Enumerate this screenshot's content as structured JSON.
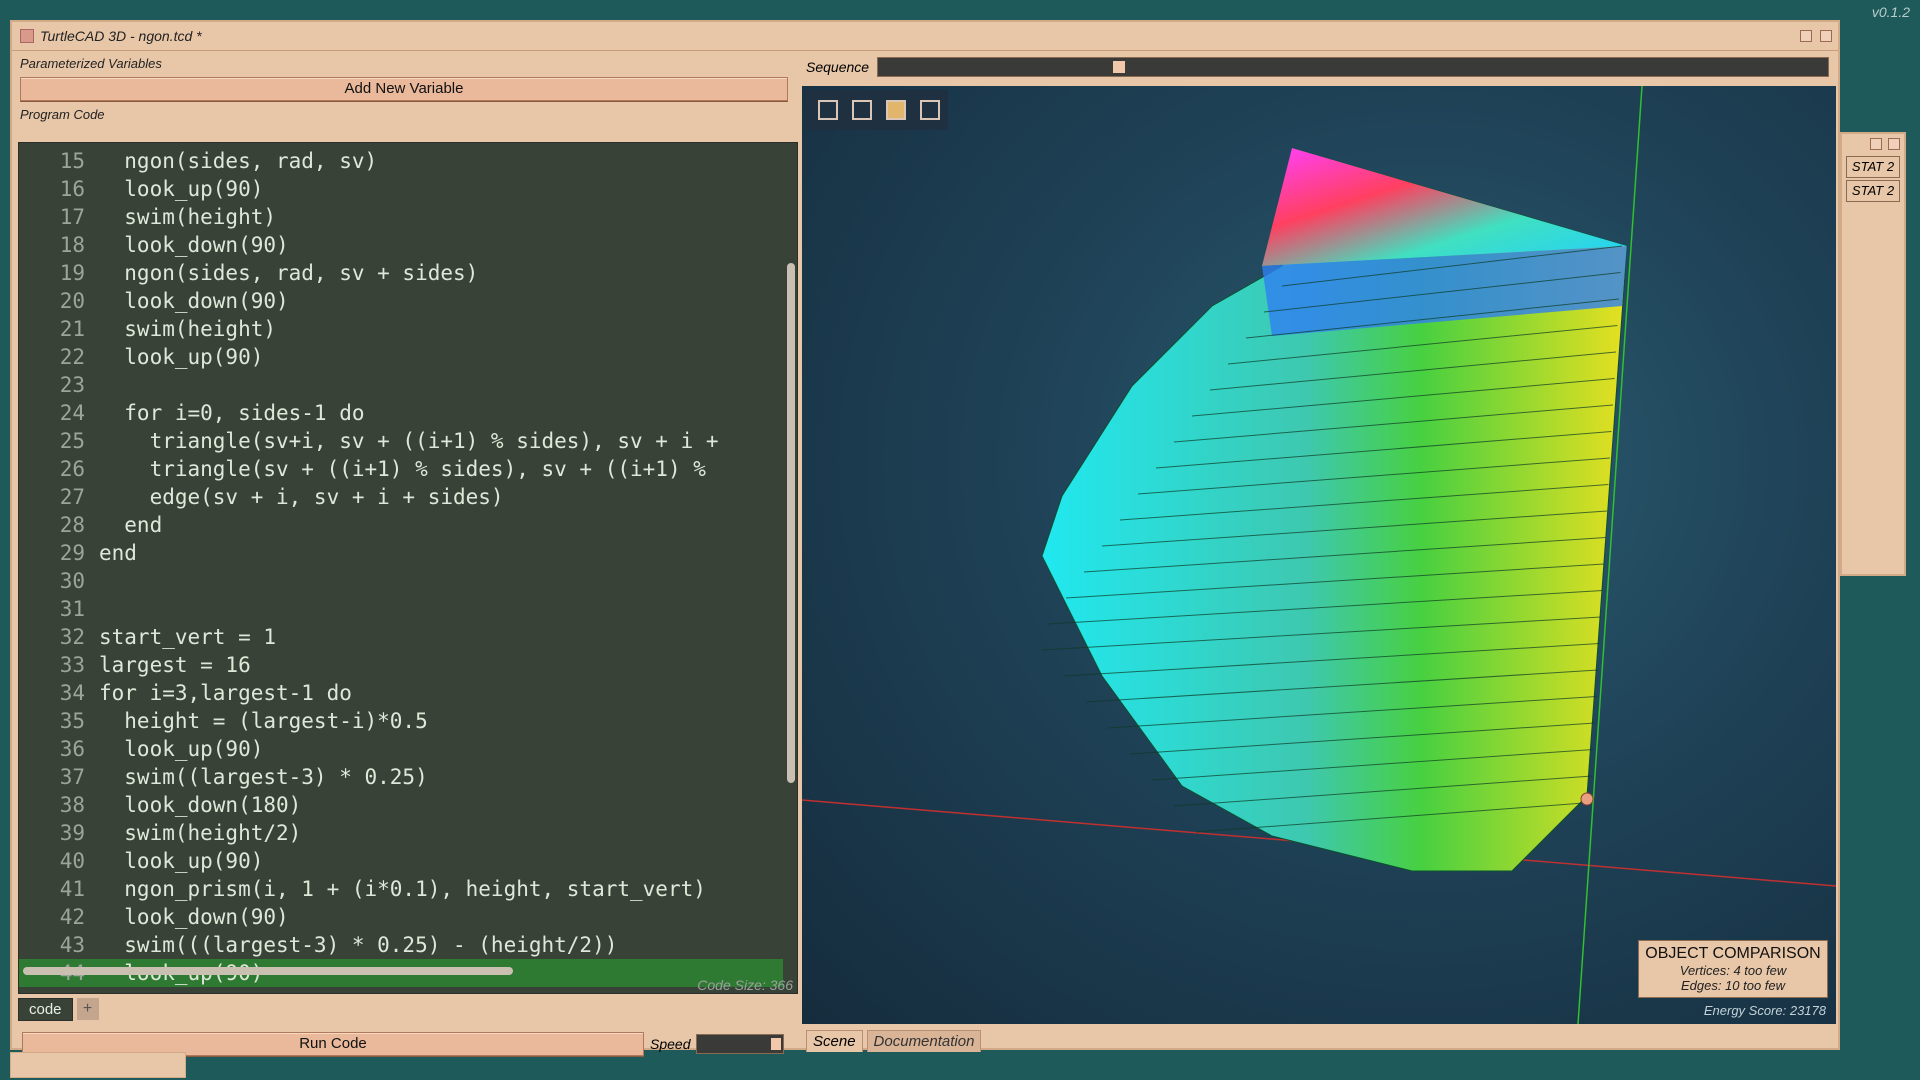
{
  "version": "v0.1.2",
  "window": {
    "title": "TurtleCAD 3D - ngon.tcd *"
  },
  "left_panel": {
    "variables_label": "Parameterized Variables",
    "add_variable_label": "Add New Variable",
    "program_code_label": "Program Code",
    "code_lines": [
      {
        "n": "15",
        "text": "  ngon(sides, rad, sv)"
      },
      {
        "n": "16",
        "text": "  look_up(90)"
      },
      {
        "n": "17",
        "text": "  swim(height)"
      },
      {
        "n": "18",
        "text": "  look_down(90)"
      },
      {
        "n": "19",
        "text": "  ngon(sides, rad, sv + sides)"
      },
      {
        "n": "20",
        "text": "  look_down(90)"
      },
      {
        "n": "21",
        "text": "  swim(height)"
      },
      {
        "n": "22",
        "text": "  look_up(90)"
      },
      {
        "n": "23",
        "text": ""
      },
      {
        "n": "24",
        "text": "  for i=0, sides-1 do"
      },
      {
        "n": "25",
        "text": "    triangle(sv+i, sv + ((i+1) % sides), sv + i +"
      },
      {
        "n": "26",
        "text": "    triangle(sv + ((i+1) % sides), sv + ((i+1) %"
      },
      {
        "n": "27",
        "text": "    edge(sv + i, sv + i + sides)"
      },
      {
        "n": "28",
        "text": "  end"
      },
      {
        "n": "29",
        "text": "end"
      },
      {
        "n": "30",
        "text": ""
      },
      {
        "n": "31",
        "text": ""
      },
      {
        "n": "32",
        "text": "start_vert = 1"
      },
      {
        "n": "33",
        "text": "largest = 16"
      },
      {
        "n": "34",
        "text": "for i=3,largest-1 do"
      },
      {
        "n": "35",
        "text": "  height = (largest-i)*0.5"
      },
      {
        "n": "36",
        "text": "  look_up(90)"
      },
      {
        "n": "37",
        "text": "  swim((largest-3) * 0.25)"
      },
      {
        "n": "38",
        "text": "  look_down(180)"
      },
      {
        "n": "39",
        "text": "  swim(height/2)"
      },
      {
        "n": "40",
        "text": "  look_up(90)"
      },
      {
        "n": "41",
        "text": "  ngon_prism(i, 1 + (i*0.1), height, start_vert)"
      },
      {
        "n": "42",
        "text": "  look_down(90)"
      },
      {
        "n": "43",
        "text": "  swim(((largest-3) * 0.25) - (height/2))"
      },
      {
        "n": "44",
        "text": "  look_up(90)"
      }
    ],
    "active_line": "44",
    "code_size": "Code Size: 366",
    "tab_code": "code",
    "tab_add": "+",
    "run_code_label": "Run Code",
    "speed_label": "Speed"
  },
  "right_panel": {
    "sequence_label": "Sequence",
    "sequence_position": 0.25,
    "tools": [
      "fit-all-icon",
      "fit-selection-icon",
      "shaded-view-icon",
      "wireframe-view-icon"
    ],
    "object_comparison": {
      "title": "OBJECT COMPARISON",
      "vertices": "Vertices: 4 too few",
      "edges": "Edges: 10 too few"
    },
    "energy_score": "Energy Score: 23178",
    "tabs": [
      "Scene",
      "Documentation"
    ]
  },
  "stats_window": {
    "items": [
      "STAT 2",
      "STAT 2"
    ]
  },
  "colors": {
    "desktop": "#1e5a5a",
    "window": "#e8c6a8",
    "code_bg": "#394237",
    "active_line": "#2f7a33",
    "viewport": "#1f4257"
  }
}
